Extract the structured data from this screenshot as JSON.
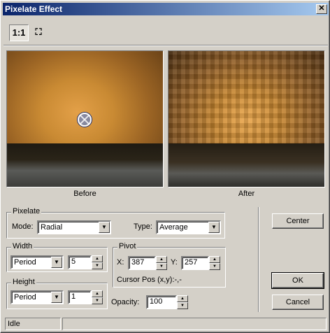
{
  "window": {
    "title": "Pixelate Effect",
    "close_glyph": "✕"
  },
  "toolbar": {
    "actual_size_label": "1:1",
    "fit_icon_glyph": "⛶"
  },
  "preview": {
    "before_label": "Before",
    "after_label": "After"
  },
  "pixelate": {
    "group_label": "Pixelate",
    "mode_label": "Mode:",
    "mode_value": "Radial",
    "type_label": "Type:",
    "type_value": "Average"
  },
  "width": {
    "group_label": "Width",
    "unit_value": "Period",
    "amount": "5"
  },
  "height": {
    "group_label": "Height",
    "unit_value": "Period",
    "amount": "1"
  },
  "pivot": {
    "group_label": "Pivot",
    "x_label": "X:",
    "x_value": "387",
    "y_label": "Y:",
    "y_value": "257",
    "cursor_text": "Cursor Pos (x,y):-,-"
  },
  "opacity": {
    "label": "Opacity:",
    "value": "100"
  },
  "buttons": {
    "center": "Center",
    "ok": "OK",
    "cancel": "Cancel"
  },
  "status": {
    "text": "Idle",
    "secondary": ""
  },
  "icons": {
    "dropdown": "▼",
    "spin_up": "▲",
    "spin_down": "▼"
  }
}
